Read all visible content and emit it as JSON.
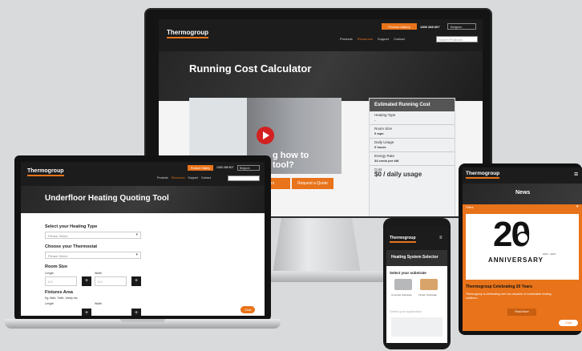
{
  "desktop": {
    "logo": "Thermogroup",
    "header_button": "Product Gallery",
    "phone": "1300 268 607",
    "region": "Belgium",
    "nav": [
      "Products",
      "Resources",
      "Support",
      "Contact"
    ],
    "search_placeholder": "Search Products...",
    "hero_title": "Running Cost Calculator",
    "video_caption_line1": "g how to",
    "video_caption_line2": "tool?",
    "btn_left": "rers",
    "btn_right": "Request a Quote",
    "estimate": {
      "title": "Estimated Running Cost",
      "rows": [
        {
          "label": "Heating Type",
          "value": "-"
        },
        {
          "label": "Room Size",
          "value": "0 sqm"
        },
        {
          "label": "Daily Usage",
          "value": "0 hours"
        },
        {
          "label": "Energy Rate",
          "value": "34 cents per kW"
        },
        {
          "label": "Cost",
          "value": "$0 / daily usage"
        }
      ]
    }
  },
  "laptop": {
    "logo": "Thermogroup",
    "header_button": "Product Gallery",
    "phone": "1300 268 607",
    "region": "Belgium",
    "nav": [
      "Products",
      "Resources",
      "Support",
      "Contact"
    ],
    "hero_title": "Underfloor Heating Quoting Tool",
    "heating_type_label": "Select your Heating Type",
    "heating_type_value": "Please Select",
    "thermostat_label": "Choose your Thermostat",
    "thermostat_value": "Please Select",
    "room_size_label": "Room Size",
    "length_label": "Length",
    "width_label": "Width",
    "length_value": "0.0",
    "width_value": "0.0",
    "fixtures_label": "Fixtures Area",
    "fixtures_hint": "Eg. Bath, Toilet, Vanity etc.",
    "chat": "Chat"
  },
  "phone": {
    "logo": "Thermogroup",
    "hero_title": "Heating System Selector",
    "substrate_label": "Select your substrate",
    "option_1": "Concrete Substrate",
    "option_2": "Timber Substrate",
    "application_label": "Select your application"
  },
  "tablet": {
    "logo": "Thermogroup",
    "hero_title": "News",
    "filter": "Filters",
    "anniv_big": "20",
    "anniv_text": "ANNIVERSARY",
    "years": "2003 - 2023",
    "news_title": "Thermogroup Celebrating 20 Years",
    "news_body": "Thermogroup is celebrating over two decades of comfortable heating solutions...",
    "read_more": "Read More",
    "chat": "Chat"
  }
}
